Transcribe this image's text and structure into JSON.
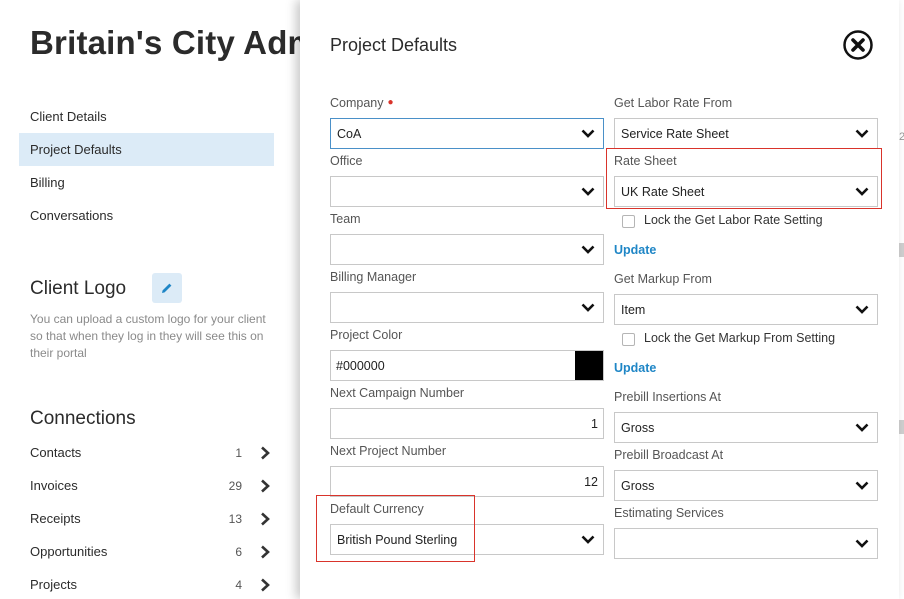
{
  "background": {
    "title": "Britain's City Adm",
    "nav": [
      "Client Details",
      "Project Defaults",
      "Billing",
      "Conversations"
    ],
    "client_logo": {
      "heading": "Client Logo",
      "description": "You can upload a custom logo for your client so that when they log in they will see this on their portal"
    },
    "connections": {
      "heading": "Connections",
      "items": [
        {
          "label": "Contacts",
          "count": "1"
        },
        {
          "label": "Invoices",
          "count": "29"
        },
        {
          "label": "Receipts",
          "count": "13"
        },
        {
          "label": "Opportunities",
          "count": "6"
        },
        {
          "label": "Projects",
          "count": "4"
        }
      ]
    },
    "edge_text": "2"
  },
  "modal": {
    "title": "Project Defaults",
    "left": {
      "company": {
        "label": "Company",
        "value": "CoA"
      },
      "office": {
        "label": "Office",
        "value": ""
      },
      "team": {
        "label": "Team",
        "value": ""
      },
      "billing_manager": {
        "label": "Billing Manager",
        "value": ""
      },
      "project_color": {
        "label": "Project Color",
        "value": "#000000"
      },
      "next_campaign": {
        "label": "Next Campaign Number",
        "value": "1"
      },
      "next_project": {
        "label": "Next Project Number",
        "value": "12"
      },
      "default_currency": {
        "label": "Default Currency",
        "value": "British Pound Sterling"
      }
    },
    "right": {
      "labor_rate_from": {
        "label": "Get Labor Rate From",
        "value": "Service Rate Sheet"
      },
      "rate_sheet": {
        "label": "Rate Sheet",
        "value": "UK Rate Sheet"
      },
      "lock_labor": {
        "label": "Lock the Get Labor Rate Setting",
        "checked": false
      },
      "update_1": "Update",
      "markup_from": {
        "label": "Get Markup From",
        "value": "Item"
      },
      "lock_markup": {
        "label": "Lock the Get Markup From Setting",
        "checked": false
      },
      "update_2": "Update",
      "prebill_insertions": {
        "label": "Prebill Insertions At",
        "value": "Gross"
      },
      "prebill_broadcast": {
        "label": "Prebill Broadcast At",
        "value": "Gross"
      },
      "estimating_services": {
        "label": "Estimating Services",
        "value": ""
      }
    }
  },
  "colors": {
    "highlight": "#d9342b",
    "link": "#1f86c6",
    "nav_active_bg": "#dcebf7"
  }
}
